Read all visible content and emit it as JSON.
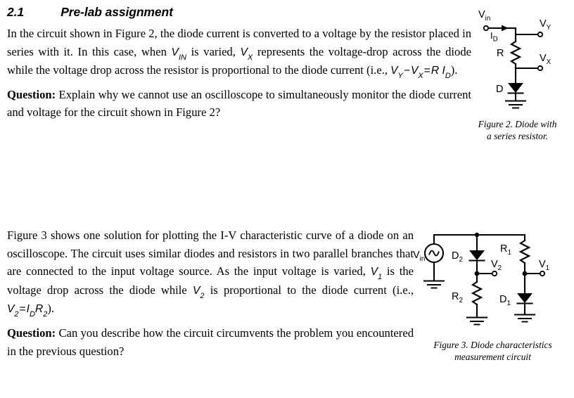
{
  "section": {
    "number": "2.1",
    "title": "Pre-lab assignment"
  },
  "body": {
    "paragraph1": {
      "t1": "In the circuit shown in Figure 2, the diode current is converted to a voltage by the resistor placed in series with it. In this case, when ",
      "m1": "V",
      "m1sub": "IN",
      "t2": " is varied, ",
      "m2": "V",
      "m2sub": "X",
      "t3": " represents the voltage-drop across the diode while the voltage drop across the resistor is proportional to the diode current (i.e., ",
      "eq_vy": "V",
      "eq_vy_sub": "Y",
      "eq_minus": "−",
      "eq_vx": "V",
      "eq_vx_sub": "X",
      "eq_eq": "=",
      "eq_r": "R",
      "eq_i": "I",
      "eq_i_sub": "D",
      "t4": ")."
    },
    "question1": {
      "label": "Question:",
      "text": " Explain why we cannot use an oscilloscope to simultaneously monitor the diode current and voltage for the circuit shown in Figure 2?"
    },
    "paragraph2": {
      "t1": "Figure 3 shows one solution for plotting the I-V characteristic curve of a diode on an oscilloscope. The circuit uses similar diodes and resistors in two parallel branches that are connected to the input voltage source. As the input voltage is varied, ",
      "m1": "V",
      "m1sub": "1",
      "t2": " is the voltage drop across the diode while ",
      "m2": "V",
      "m2sub": "2",
      "t3": " is proportional to the diode current (i.e., ",
      "eq_v2": "V",
      "eq_v2_sub": "2",
      "eq_eq": "=",
      "eq_i": "I",
      "eq_i_sub": "D",
      "eq_r2": "R",
      "eq_r2_sub": "2",
      "t4": ")."
    },
    "question2": {
      "label": "Question:",
      "text": " Can you describe how the circuit circumvents the problem you encountered in the previous question?"
    }
  },
  "figure2": {
    "caption_line1": "Figure 2. Diode with",
    "caption_line2": "a series resistor.",
    "labels": {
      "vin": "V",
      "vin_sub": "in",
      "id": "I",
      "id_sub": "D",
      "vy": "V",
      "vy_sub": "Y",
      "vx": "V",
      "vx_sub": "X",
      "resistor": "R",
      "diode": "D"
    }
  },
  "figure3": {
    "caption_line1": "Figure 3. Diode characteristics",
    "caption_line2": "measurement circuit",
    "labels": {
      "vin": "V",
      "vin_sub": "in",
      "d2": "D",
      "d2_sub": "2",
      "v2": "V",
      "v2_sub": "2",
      "r2": "R",
      "r2_sub": "2",
      "r1": "R",
      "r1_sub": "1",
      "v1": "V",
      "v1_sub": "1",
      "d1": "D",
      "d1_sub": "1"
    }
  },
  "colors": {
    "ink": "#000000",
    "page": "#ffffff"
  }
}
